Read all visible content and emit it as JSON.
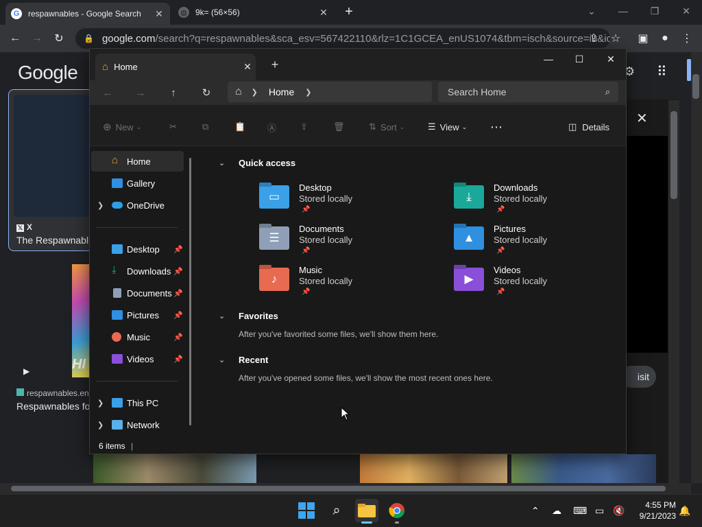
{
  "browser": {
    "tabs": [
      {
        "title": "respawnables - Google Search",
        "favicon": "google-g-icon"
      },
      {
        "title": "9k= (56×56)",
        "favicon": "globe-icon"
      }
    ],
    "new_tab": "+",
    "url_host": "google.com",
    "url_rest": "/search?q=respawnables&sca_esv=567422110&rlz=1C1GCEA_enUS1074&tbm=isch&source=iu&ict..."
  },
  "google_page": {
    "logo": "Google",
    "card1_source": "X",
    "card1_title": "The Respawnabl",
    "card2_source": "respawnables.en",
    "card2_title": "Respawnables fo",
    "visit_label": "isit",
    "thumb_text": "HI"
  },
  "explorer": {
    "tab_title": "Home",
    "breadcrumb": "Home",
    "search_placeholder": "Search Home",
    "commands": {
      "new": "New",
      "sort": "Sort",
      "view": "View",
      "details": "Details"
    },
    "sidebar": {
      "home": "Home",
      "gallery": "Gallery",
      "onedrive": "OneDrive",
      "desktop": "Desktop",
      "downloads": "Downloads",
      "documents": "Documents",
      "pictures": "Pictures",
      "music": "Music",
      "videos": "Videos",
      "thispc": "This PC",
      "network": "Network"
    },
    "sections": {
      "quick_access": "Quick access",
      "favorites": "Favorites",
      "favorites_note": "After you've favorited some files, we'll show them here.",
      "recent": "Recent",
      "recent_note": "After you've opened some files, we'll show the most recent ones here."
    },
    "quick_access": [
      {
        "name": "Desktop",
        "status": "Stored locally"
      },
      {
        "name": "Downloads",
        "status": "Stored locally"
      },
      {
        "name": "Documents",
        "status": "Stored locally"
      },
      {
        "name": "Pictures",
        "status": "Stored locally"
      },
      {
        "name": "Music",
        "status": "Stored locally"
      },
      {
        "name": "Videos",
        "status": "Stored locally"
      }
    ],
    "status": "6 items"
  },
  "taskbar": {
    "time": "4:55 PM",
    "date": "9/21/2023"
  },
  "colors": {
    "accent_blue": "#8ab4f8",
    "folder_desktop": "#3aa0e8",
    "folder_downloads": "#1aa89a",
    "folder_documents": "#8f9fb8",
    "folder_pictures": "#2f8fe0",
    "folder_music": "#e86a50",
    "folder_videos": "#8a4fd8"
  }
}
